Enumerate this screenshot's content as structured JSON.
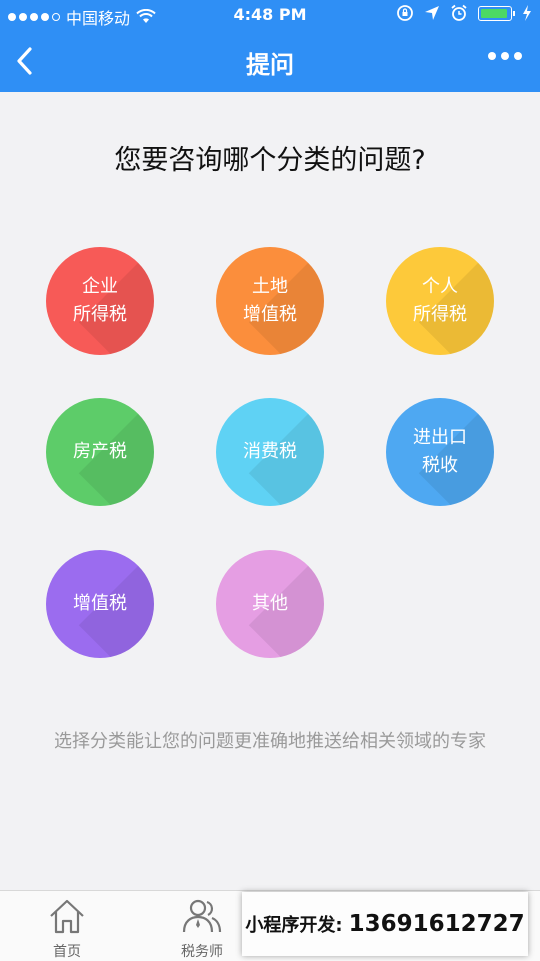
{
  "status_bar": {
    "carrier": "中国移动",
    "time": "4:48 PM"
  },
  "nav": {
    "title": "提问",
    "back_icon": "chevron-left-icon",
    "more_icon": "more-dots-icon"
  },
  "question": "您要咨询哪个分类的问题?",
  "categories": [
    {
      "line1": "企业",
      "line2": "所得税",
      "color": "#f75a57"
    },
    {
      "line1": "土地",
      "line2": "增值税",
      "color": "#fb8e3c"
    },
    {
      "line1": "个人",
      "line2": "所得税",
      "color": "#fdc93a"
    },
    {
      "line1": "房产税",
      "line2": "",
      "color": "#5dcc69"
    },
    {
      "line1": "消费税",
      "line2": "",
      "color": "#5fd2f4"
    },
    {
      "line1": "进出口",
      "line2": "税收",
      "color": "#4ea8f2"
    },
    {
      "line1": "增值税",
      "line2": "",
      "color": "#9b6cef"
    },
    {
      "line1": "其他",
      "line2": "",
      "color": "#e59ee3"
    }
  ],
  "hint": "选择分类能让您的问题更准确地推送给相关领域的专家",
  "tabs": [
    {
      "label": "首页",
      "icon": "home-icon"
    },
    {
      "label": "税务师",
      "icon": "people-icon"
    }
  ],
  "promo": {
    "label": "小程序开发:",
    "phone": "13691612727"
  }
}
